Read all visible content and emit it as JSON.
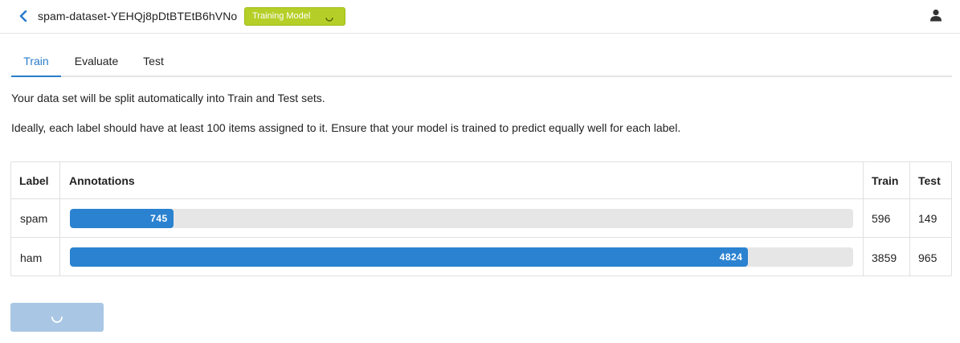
{
  "header": {
    "dataset_name": "spam-dataset-YEHQj8pDtBTEtB6hVNo",
    "status_badge": "Training Model",
    "icons": {
      "back": "chevron-left-icon",
      "user": "user-icon"
    },
    "colors": {
      "badge": "#b5cf28",
      "accent": "#2a7ccc"
    }
  },
  "tabs": [
    {
      "label": "Train",
      "active": true
    },
    {
      "label": "Evaluate",
      "active": false
    },
    {
      "label": "Test",
      "active": false
    }
  ],
  "intro": {
    "line1": "Your data set will be split automatically into Train and Test sets.",
    "line2": "Ideally, each label should have at least 100 items assigned to it. Ensure that your model is trained to predict equally well for each label."
  },
  "table": {
    "headers": {
      "label": "Label",
      "annotations": "Annotations",
      "train": "Train",
      "test": "Test"
    },
    "rows": [
      {
        "label": "spam",
        "annotations": "745",
        "train": "596",
        "test": "149",
        "fill_fraction": 0.132
      },
      {
        "label": "ham",
        "annotations": "4824",
        "train": "3859",
        "test": "965",
        "fill_fraction": 0.866
      }
    ]
  },
  "train_button": {
    "state": "loading"
  }
}
